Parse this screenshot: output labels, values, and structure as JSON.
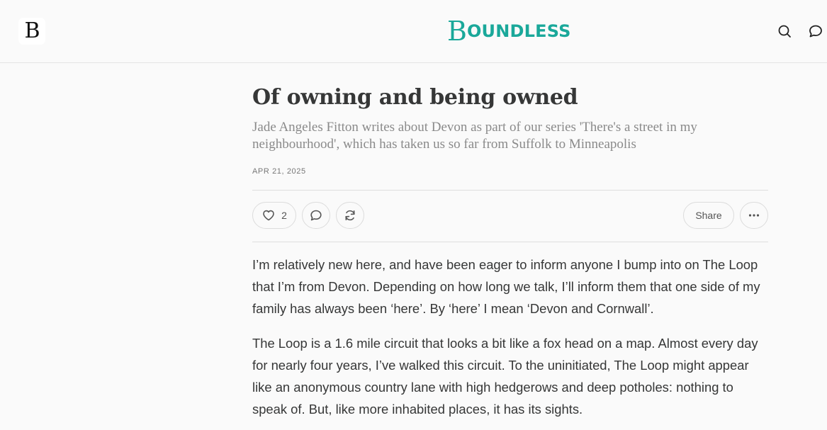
{
  "header": {
    "logo_text": "B",
    "wordmark_b": "B",
    "wordmark_rest": "OUNDLESS",
    "brand_color": "#1aa89a",
    "icons": [
      "search-icon",
      "chat-bubble-icon"
    ]
  },
  "article": {
    "title": "Of owning and being owned",
    "subtitle": "Jade Angeles Fitton writes about Devon as part of our series 'There's a street in my neighbourhood', which has taken us so far from Suffolk to Minneapolis",
    "date": "APR 21, 2025",
    "actions": {
      "like_count": "2",
      "share_label": "Share"
    },
    "paragraphs": [
      "I’m relatively new here, and have been eager to inform anyone I bump into on The Loop that I’m from Devon. Depending on how long we talk, I’ll inform them that one side of my family has always been ‘here’. By ‘here’ I mean ‘Devon and Cornwall’.",
      "The Loop is a 1.6 mile circuit that looks a bit like a fox head on a map. Almost every day for nearly four years, I’ve walked this circuit. To the uninitiated, The Loop might appear like an anonymous country lane with high hedgerows and deep potholes: nothing to speak of. But, like more inhabited places, it has its sights."
    ]
  }
}
